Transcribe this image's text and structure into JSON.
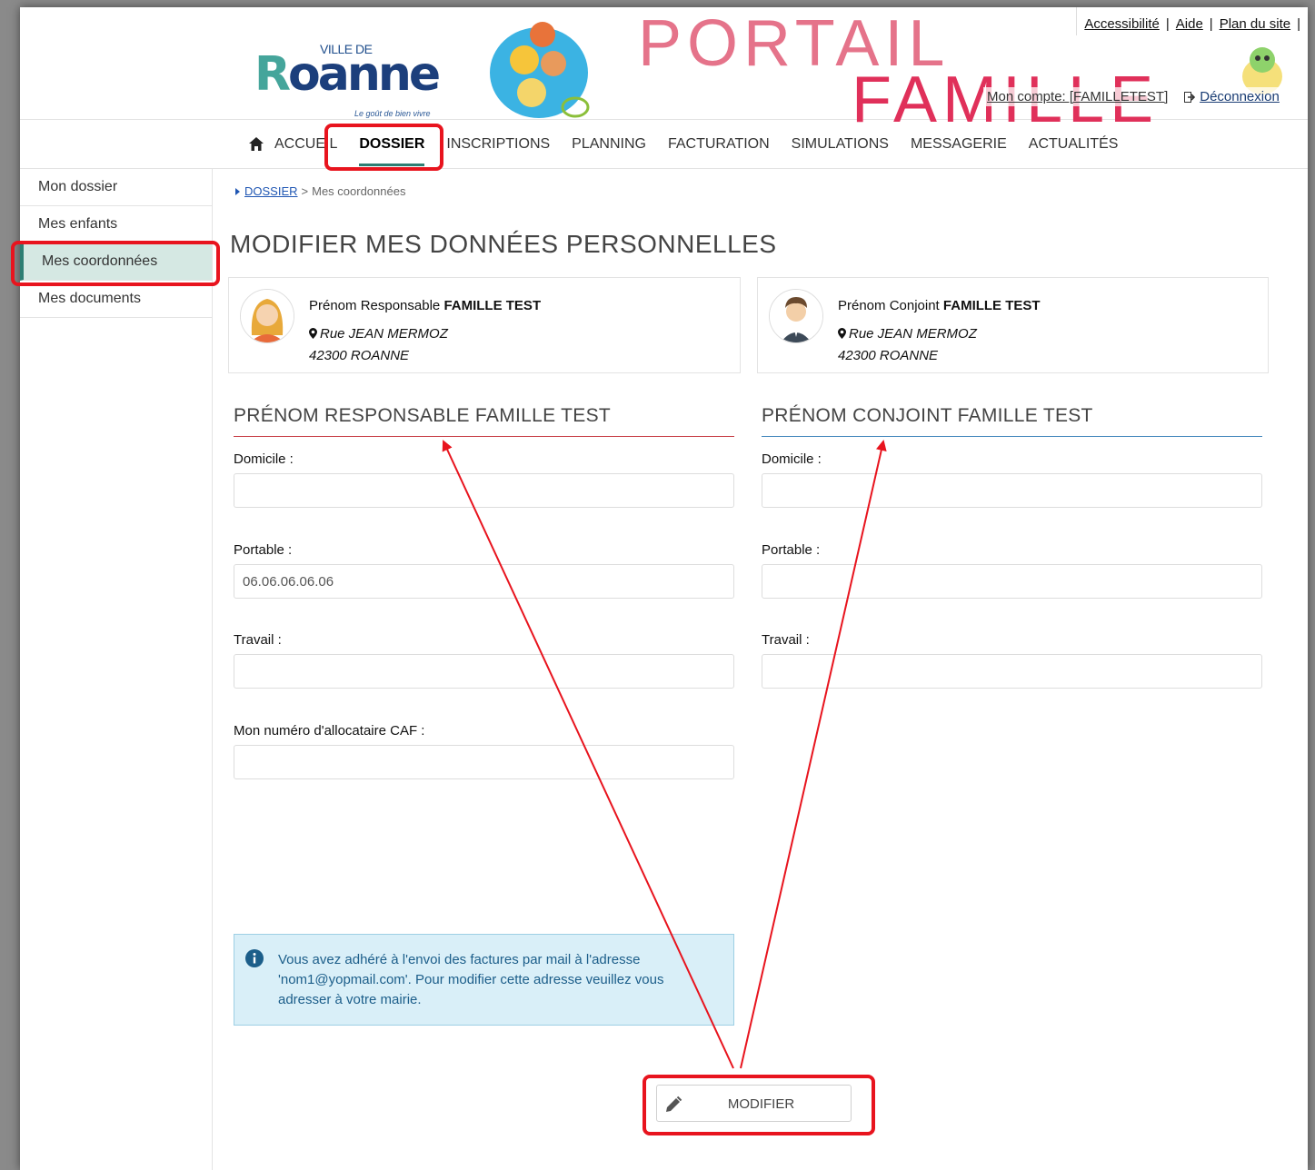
{
  "header": {
    "logo_ville": "VILLE DE",
    "logo_name": "Roanne",
    "logo_slogan": "Le goût de bien vivre",
    "portail": "PORTAIL",
    "famille": "FAMILLE",
    "toplinks": [
      "Accessibilité",
      "Aide",
      "Plan du site"
    ],
    "account": "Mon compte: [FAMILLETEST]",
    "logout": "Déconnexion"
  },
  "nav": {
    "items": [
      "ACCUEIL",
      "DOSSIER",
      "INSCRIPTIONS",
      "PLANNING",
      "FACTURATION",
      "SIMULATIONS",
      "MESSAGERIE",
      "ACTUALITÉS"
    ],
    "active": "DOSSIER"
  },
  "sidebar": {
    "items": [
      "Mon dossier",
      "Mes enfants",
      "Mes coordonnées",
      "Mes documents"
    ],
    "active": "Mes coordonnées"
  },
  "breadcrumb": {
    "link": "DOSSIER",
    "current": "Mes coordonnées"
  },
  "page_title": "MODIFIER MES DONNÉES PERSONNELLES",
  "cards": [
    {
      "prefix": "Prénom Responsable",
      "name": "FAMILLE TEST",
      "street": "Rue JEAN MERMOZ",
      "city": "42300 ROANNE"
    },
    {
      "prefix": "Prénom Conjoint",
      "name": "FAMILLE TEST",
      "street": "Rue JEAN MERMOZ",
      "city": "42300 ROANNE"
    }
  ],
  "responsable": {
    "title": "PRÉNOM RESPONSABLE FAMILLE TEST",
    "domicile_label": "Domicile :",
    "domicile_value": "",
    "portable_label": "Portable :",
    "portable_value": "06.06.06.06.06",
    "travail_label": "Travail :",
    "travail_value": "",
    "caf_label": "Mon numéro d'allocataire CAF :",
    "caf_value": "",
    "accent": "#c9434b"
  },
  "conjoint": {
    "title": "PRÉNOM CONJOINT FAMILLE TEST",
    "domicile_label": "Domicile :",
    "domicile_value": "",
    "portable_label": "Portable :",
    "portable_value": "",
    "travail_label": "Travail :",
    "travail_value": "",
    "accent": "#4a8bbf"
  },
  "info_message": "Vous avez adhéré à l'envoi des factures par mail à l'adresse 'nom1@yopmail.com'. Pour modifier cette adresse veuillez vous adresser à votre mairie.",
  "modify_button": "MODIFIER",
  "colors": {
    "active_green": "#2d7e73",
    "highlight_red": "#e8141e",
    "portail_pink": "#e5738a",
    "famille_red": "#e0305a"
  }
}
